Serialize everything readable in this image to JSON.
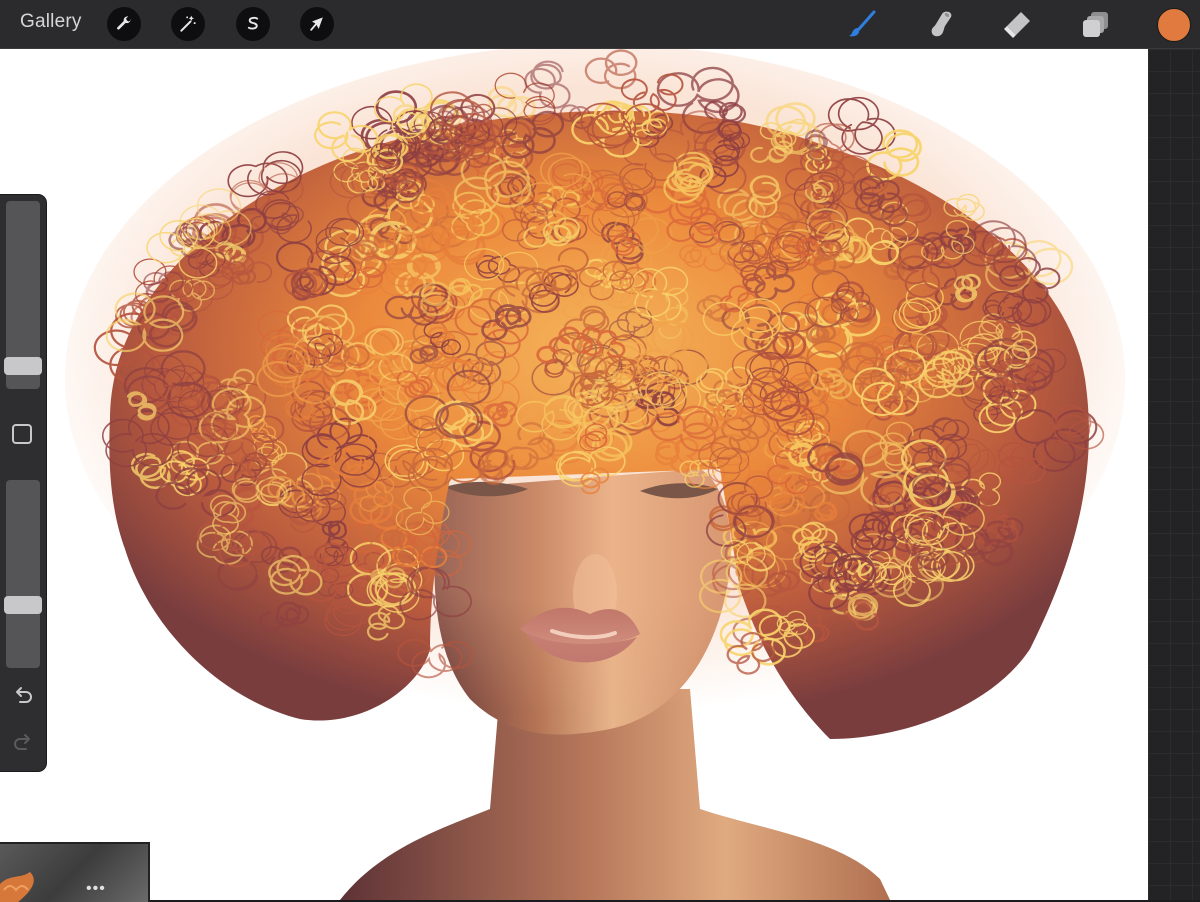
{
  "toolbar": {
    "gallery_label": "Gallery",
    "left_tools": [
      {
        "name": "actions",
        "icon": "wrench-icon"
      },
      {
        "name": "adjustments",
        "icon": "magic-wand-icon"
      },
      {
        "name": "selection",
        "icon": "selection-s-icon"
      },
      {
        "name": "transform",
        "icon": "arrow-cursor-icon"
      }
    ],
    "right_tools": [
      {
        "name": "brush",
        "icon": "brush-icon",
        "active": true
      },
      {
        "name": "smudge",
        "icon": "smudge-finger-icon"
      },
      {
        "name": "eraser",
        "icon": "eraser-icon"
      },
      {
        "name": "layers",
        "icon": "layers-icon"
      }
    ],
    "current_color": "#e07a3f",
    "active_color": "#2f7fe0"
  },
  "sidebar": {
    "brush_size_level": 0.08,
    "opacity_level": 0.32,
    "undo_icon": "undo-arrow-icon",
    "redo_icon": "redo-arrow-icon",
    "modify_icon": "square-modify-icon"
  },
  "reference": {
    "more_label": "•••"
  }
}
